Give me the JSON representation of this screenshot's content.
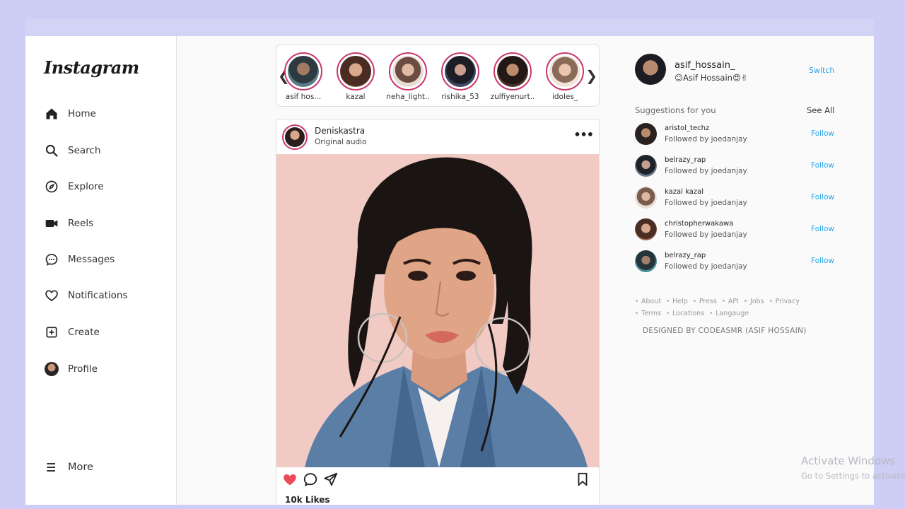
{
  "app": {
    "logo": "Instagram"
  },
  "nav": [
    {
      "key": "home",
      "label": "Home",
      "icon": "home-icon"
    },
    {
      "key": "search",
      "label": "Search",
      "icon": "search-icon"
    },
    {
      "key": "explore",
      "label": "Explore",
      "icon": "compass-icon"
    },
    {
      "key": "reels",
      "label": "Reels",
      "icon": "video-camera-icon"
    },
    {
      "key": "messages",
      "label": "Messages",
      "icon": "chat-bubble-icon"
    },
    {
      "key": "notifications",
      "label": "Notifications",
      "icon": "heart-icon"
    },
    {
      "key": "create",
      "label": "Create",
      "icon": "plus-square-icon"
    },
    {
      "key": "profile",
      "label": "Profile",
      "icon": "profile-avatar"
    }
  ],
  "more": {
    "label": "More",
    "icon": "hamburger-icon"
  },
  "stories": [
    {
      "name": "asif hos..."
    },
    {
      "name": "kazal"
    },
    {
      "name": "neha_light.."
    },
    {
      "name": "rishika_53"
    },
    {
      "name": "zulfiyenurt.."
    },
    {
      "name": "idoles_"
    }
  ],
  "story_arrows": {
    "prev": "❮",
    "next": "❯"
  },
  "post": {
    "username": "Deniskastra",
    "subtitle": "Original audio",
    "more": "•••",
    "likes": "10k Likes",
    "liked": true,
    "like_color": "#ed4956"
  },
  "me": {
    "username": "asif_hossain_",
    "name": "☺Asif Hossain😍✌",
    "switch_label": "Switch"
  },
  "suggestions": {
    "title": "Suggestions for you",
    "see_all": "See All",
    "items": [
      {
        "username": "aristol_techz",
        "followed_by": "Followed by joedanjay",
        "follow": "Follow"
      },
      {
        "username": "belrazy_rap",
        "followed_by": "Followed by joedanjay",
        "follow": "Follow"
      },
      {
        "username": "kazal kazal",
        "followed_by": "Followed by joedanjay",
        "follow": "Follow"
      },
      {
        "username": "christopherwakawa",
        "followed_by": "Followed by joedanjay",
        "follow": "Follow"
      },
      {
        "username": "belrazy_rap",
        "followed_by": "Followed by joedanjay",
        "follow": "Follow"
      }
    ]
  },
  "footer": {
    "links_row1": [
      "About",
      "Help",
      "Press",
      "API",
      "Jobs",
      "Privacy"
    ],
    "links_row2": [
      "Terms",
      "Locations",
      "Langauge"
    ],
    "designed": "DESIGNED BY CODEASMR (ASIF HOSSAIN)"
  },
  "watermark": {
    "line1": "Activate Windows",
    "line2": "Go to Settings to activate Windows."
  },
  "colors": {
    "accent": "#2aa3e6",
    "story_ring": "#c9356e",
    "background": "#cdcdf6"
  }
}
